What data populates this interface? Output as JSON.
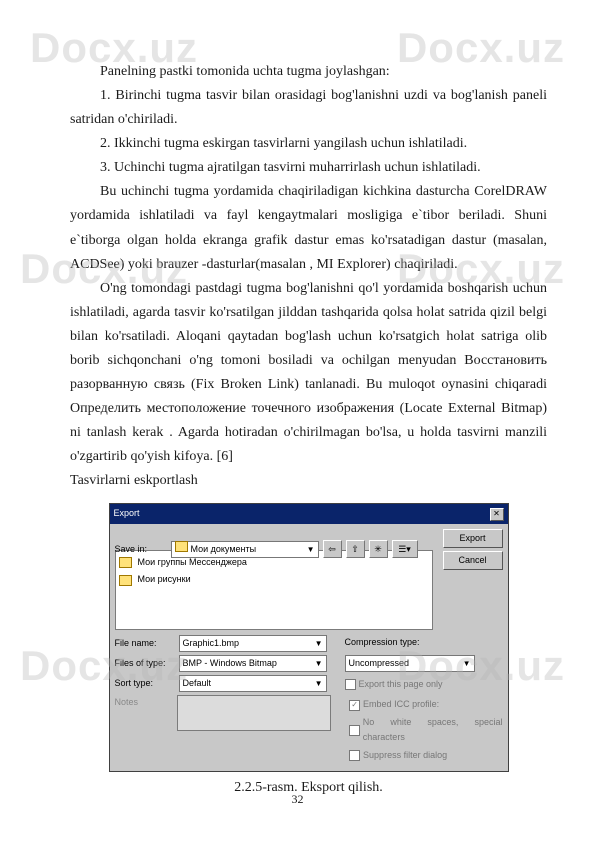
{
  "watermark": "Docx.uz",
  "paragraphs": {
    "p1": "Panelning pastki tomonida uchta tugma joylashgan:",
    "li1": "1.       Birinchi tugma tasvir bilan orasidagi bog'lanishni uzdi va bog'lanish paneli satridan o'chiriladi.",
    "li2": "2.       Ikkinchi tugma eskirgan tasvirlarni yangilash uchun ishlatiladi.",
    "li3": "3.       Uchinchi tugma ajratilgan tasvirni muharrirlash uchun ishlatiladi.",
    "p2": "Bu uchinchi tugma yordamida chaqiriladigan kichkina dasturcha CorelDRAW yordamida ishlatiladi va fayl kengaytmalari mosligiga e`tibor beriladi. Shuni e`tiborga olgan holda ekranga grafik dastur emas ko'rsatadigan dastur (masalan, ACDSee) yoki brauzer -dasturlar(masalan , MI Explorer) chaqiriladi.",
    "p3": "O'ng tomondagi pastdagi tugma bog'lanishni qo'l yordamida boshqarish uchun ishlatiladi, agarda tasvir ko'rsatilgan jilddan tashqarida qolsa holat satrida qizil belgi bilan ko'rsatiladi. Aloqani qaytadan bog'lash uchun ko'rsatgich holat satriga olib borib sichqonchani o'ng tomoni bosiladi va ochilgan menyudan Восстановить разорванную связь (Fix Broken Link) tanlanadi. Bu muloqot oynasini chiqaradi Определить местоположение точечного изображения (Locate External Bitmap) ni tanlash kerak . Agarda hotiradan o'chirilmagan bo'lsa, u holda tasvirni manzili o'zgartirib qo'yish kifoya. [6]",
    "p4": "Tasvirlarni eskportlash"
  },
  "dialog": {
    "title": "Export",
    "close": "✕",
    "save_in_label": "Save in:",
    "save_in_value": "Мои документы",
    "files": {
      "f1": "Мои группы Мессенджера",
      "f2": "Мои рисунки"
    },
    "file_name_label": "File name:",
    "file_name_value": "Graphic1.bmp",
    "files_of_type_label": "Files of type:",
    "files_of_type_value": "BMP - Windows Bitmap",
    "sort_type_label": "Sort type:",
    "sort_type_value": "Default",
    "compression_label": "Compression type:",
    "compression_value": "Uncompressed",
    "export_page_only": "Export this page only",
    "notes": "Notes",
    "embed_icc": "Embed ICC profile:",
    "no_white": "No white spaces, special characters",
    "suppress": "Suppress filter dialog",
    "export_btn": "Export",
    "cancel_btn": "Cancel"
  },
  "caption": "2.2.5-rasm. Eksport qilish.",
  "page_number": "32"
}
